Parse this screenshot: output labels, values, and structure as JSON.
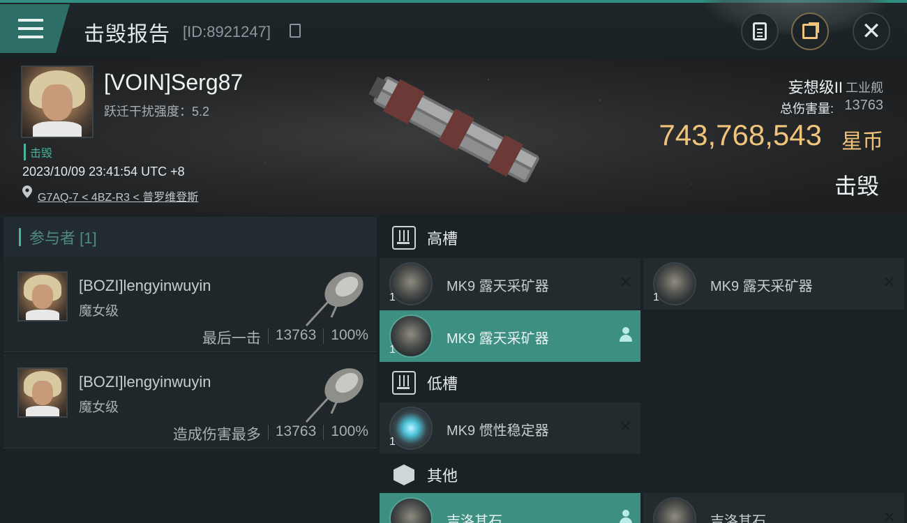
{
  "header": {
    "title": "击毁报告",
    "id_text": "[ID:8921247]"
  },
  "victim": {
    "pilot_name": "[VOIN]Serg87",
    "warp_label": "跃迁干扰强度：5.2",
    "status": "击毁",
    "timestamp": "2023/10/09 23:41:54 UTC +8",
    "location": "G7AQ-7 < 4BZ-R3 < 普罗维登斯",
    "ship_name": "妄想级II",
    "ship_class": "工业舰",
    "damage_label": "总伤害量:",
    "damage_value": "13763",
    "isk_value": "743,768,543",
    "isk_unit": "星币",
    "result": "击毁"
  },
  "participants": {
    "label": "参与者 [1]",
    "items": [
      {
        "name": "[BOZI]lengyinwuyin",
        "ship": "魔女级",
        "role": "最后一击",
        "damage": "13763",
        "percent": "100%"
      },
      {
        "name": "[BOZI]lengyinwuyin",
        "ship": "魔女级",
        "role": "造成伤害最多",
        "damage": "13763",
        "percent": "100%"
      }
    ]
  },
  "fitting": {
    "high_label": "高槽",
    "low_label": "低槽",
    "other_label": "其他",
    "high": [
      {
        "name": "MK9 露天采矿器",
        "qty": "1",
        "state": "destroyed"
      },
      {
        "name": "MK9 露天采矿器",
        "qty": "1",
        "state": "destroyed"
      },
      {
        "name": "MK9 露天采矿器",
        "qty": "1",
        "state": "dropped"
      }
    ],
    "low": [
      {
        "name": "MK9 惯性稳定器",
        "qty": "1",
        "state": "destroyed"
      }
    ],
    "other": [
      {
        "name": "吉洛其石",
        "qty": "",
        "state": "dropped"
      },
      {
        "name": "吉洛其石",
        "qty": "",
        "state": "destroyed"
      }
    ]
  },
  "icons": {
    "close": "✕",
    "destroyed": "✕"
  },
  "colors": {
    "accent": "#4bb3a0",
    "isk_gold": "#f0c47a",
    "active_row": "#3c8f81"
  }
}
